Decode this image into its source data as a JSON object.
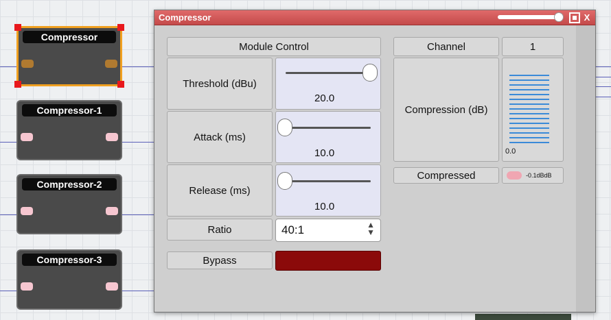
{
  "canvas": {
    "modules": [
      {
        "title": "Compressor",
        "selected": true
      },
      {
        "title": "Compressor-1",
        "selected": false
      },
      {
        "title": "Compressor-2",
        "selected": false
      },
      {
        "title": "Compressor-3",
        "selected": false
      }
    ]
  },
  "window": {
    "title": "Compressor",
    "close_label": "X",
    "module_control": {
      "header": "Module Control",
      "threshold": {
        "label": "Threshold (dBu)",
        "value": "20.0",
        "level": 1.0
      },
      "attack": {
        "label": "Attack (ms)",
        "value": "10.0",
        "level": 0.0
      },
      "release": {
        "label": "Release (ms)",
        "value": "10.0",
        "level": 0.0
      },
      "ratio": {
        "label": "Ratio",
        "value": "40:1"
      },
      "bypass": {
        "label": "Bypass",
        "color": "#8b0a0a"
      }
    },
    "channel": {
      "header": "Channel",
      "number": "1",
      "compression_label": "Compression (dB)",
      "compression_value": "0.0",
      "compressed_label": "Compressed",
      "compressed_value": "-0.1dBdB",
      "compressed_led_color": "#f0a6b2",
      "meter_color": "#3a8ad8"
    }
  },
  "colors": {
    "titlebar": "#d25a5a",
    "selection": "#f0a020",
    "wire": "#5a5fb8"
  }
}
